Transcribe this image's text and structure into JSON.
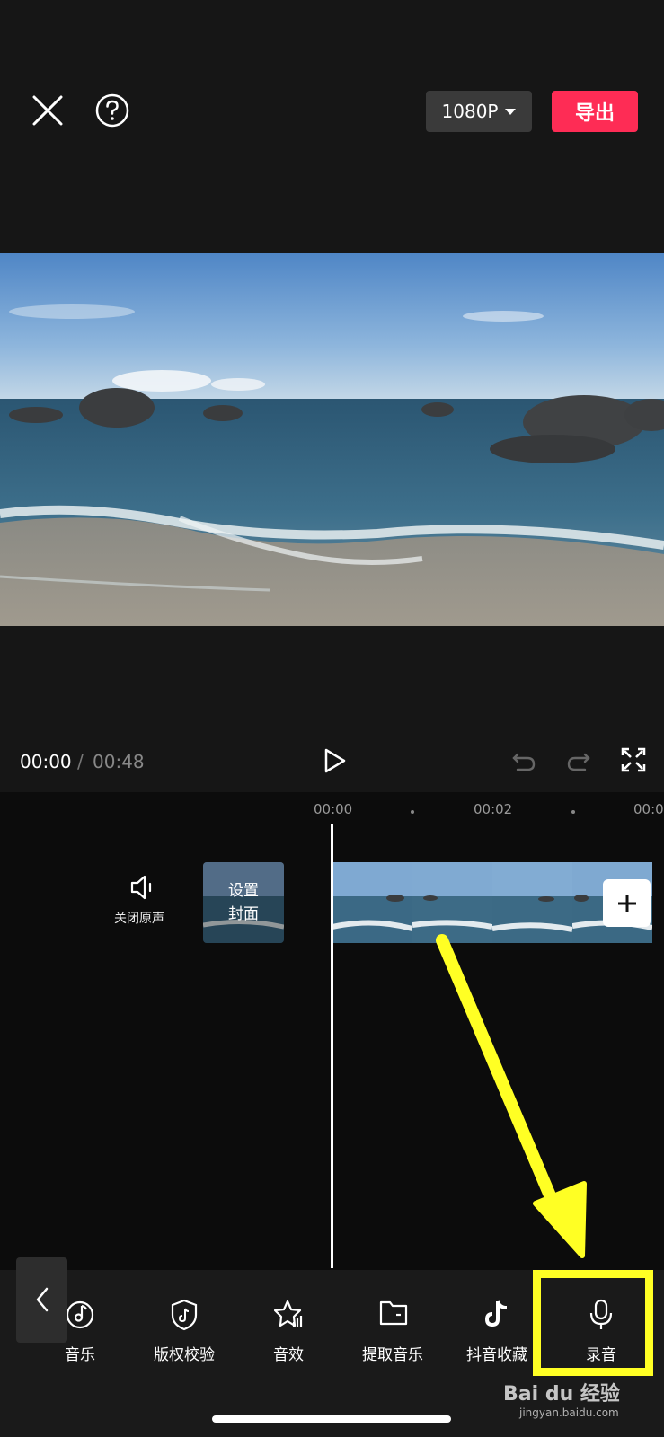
{
  "header": {
    "resolution_label": "1080P",
    "export_label": "导出"
  },
  "playback": {
    "current_time": "00:00",
    "separator": "/",
    "total_time": "00:48"
  },
  "timeline": {
    "ticks": [
      "00:00",
      "00:02",
      "00:0"
    ],
    "mute_label": "关闭原声",
    "cover_line1": "设置",
    "cover_line2": "封面"
  },
  "toolbar": {
    "items": [
      {
        "label": "音乐",
        "icon": "music-note-icon"
      },
      {
        "label": "版权校验",
        "icon": "shield-tiktok-icon"
      },
      {
        "label": "音效",
        "icon": "star-sound-icon"
      },
      {
        "label": "提取音乐",
        "icon": "folder-icon"
      },
      {
        "label": "抖音收藏",
        "icon": "tiktok-icon"
      },
      {
        "label": "录音",
        "icon": "microphone-icon"
      }
    ]
  },
  "watermark": {
    "brand": "Bai du 经验",
    "site": "jingyan.baidu.com"
  },
  "colors": {
    "export": "#fe2c55",
    "annotation": "#ffff24",
    "background": "#161616"
  }
}
